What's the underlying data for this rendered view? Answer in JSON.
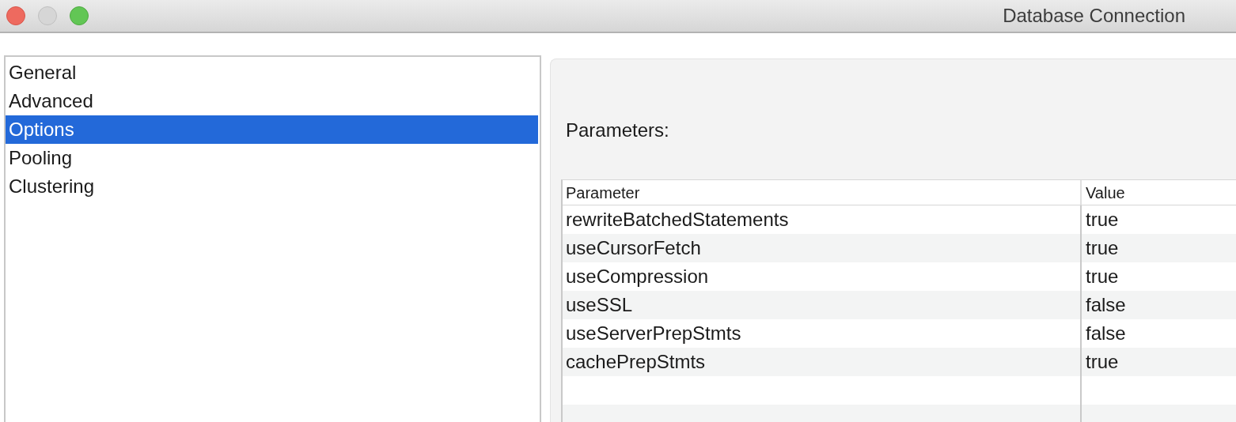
{
  "window": {
    "title": "Database Connection"
  },
  "sidebar": {
    "items": [
      {
        "label": "General",
        "selected": false
      },
      {
        "label": "Advanced",
        "selected": false
      },
      {
        "label": "Options",
        "selected": true
      },
      {
        "label": "Pooling",
        "selected": false
      },
      {
        "label": "Clustering",
        "selected": false
      }
    ]
  },
  "panel": {
    "heading": "Parameters:",
    "table": {
      "columns": [
        "Parameter",
        "Value"
      ],
      "rows": [
        [
          "rewriteBatchedStatements",
          "true"
        ],
        [
          "useCursorFetch",
          "true"
        ],
        [
          "useCompression",
          "true"
        ],
        [
          "useSSL",
          "false"
        ],
        [
          "useServerPrepStmts",
          "false"
        ],
        [
          "cachePrepStmts",
          "true"
        ]
      ]
    }
  }
}
